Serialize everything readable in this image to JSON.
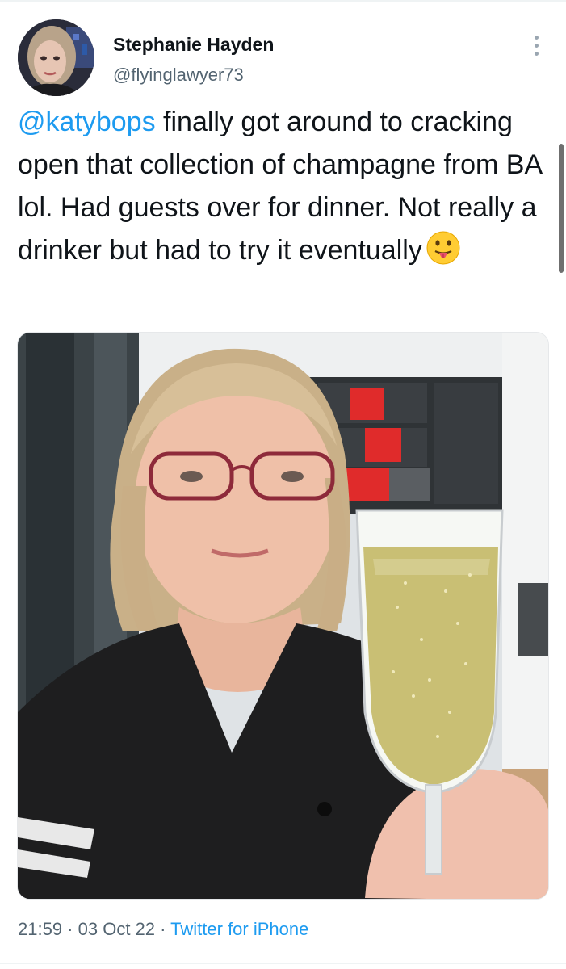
{
  "tweet": {
    "author_name": "Stephanie Hayden",
    "author_handle": "@flyinglawyer73",
    "mention": "@katybops",
    "text": " finally got around to cracking open that collection of champagne from BA lol. Had guests over for dinner. Not really a drinker but had to try it eventually",
    "emoji": "face-with-tongue",
    "time": "21:59",
    "separator": " · ",
    "date": "03 Oct 22",
    "source": "Twitter for iPhone"
  },
  "colors": {
    "text": "#0f1419",
    "secondary": "#536471",
    "link": "#1d9bf0"
  },
  "icons": {
    "more": "more-vertical-icon"
  }
}
